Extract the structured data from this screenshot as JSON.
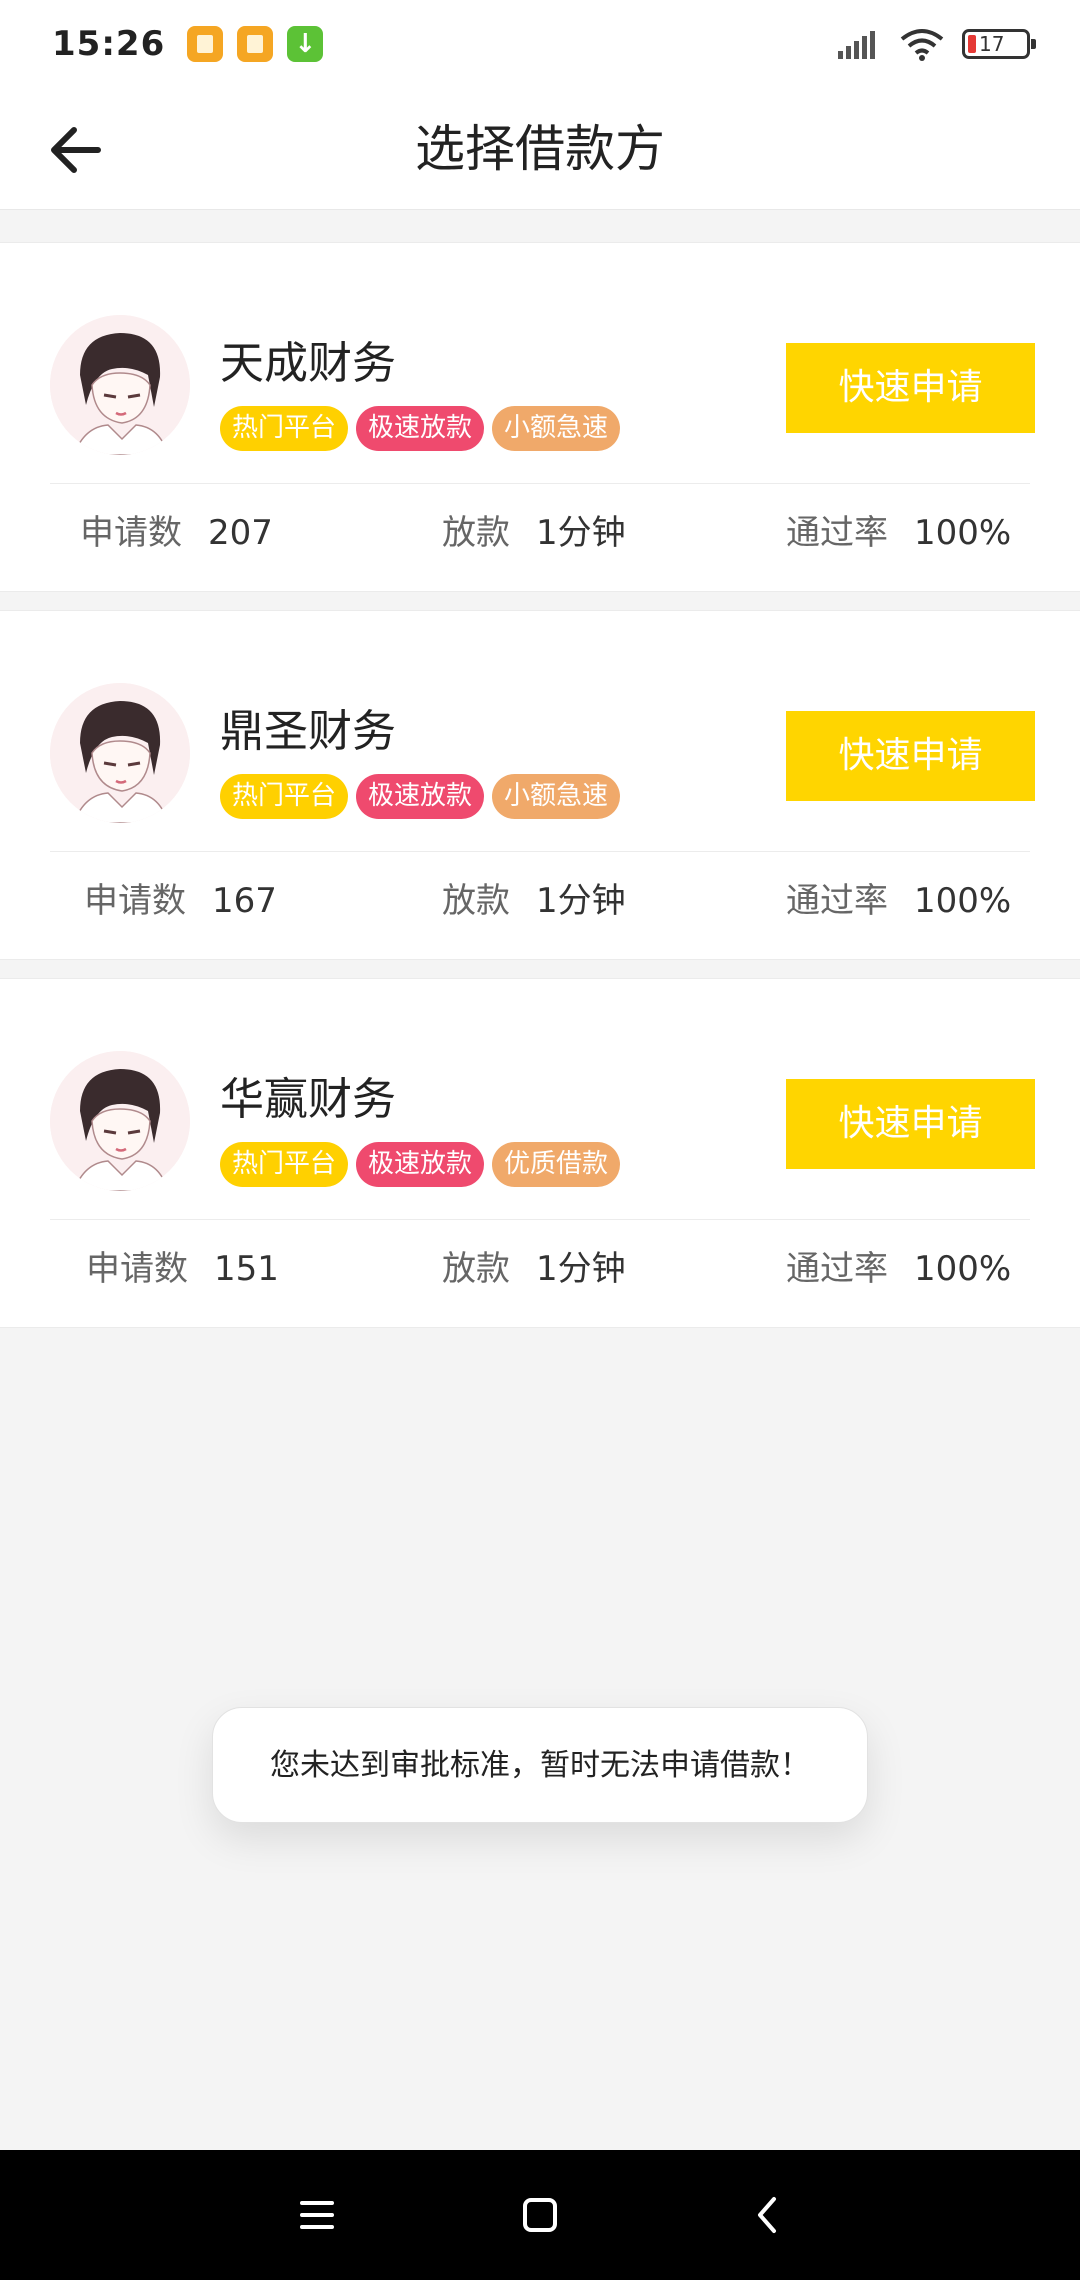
{
  "status_bar": {
    "time": "15:26",
    "battery": "17",
    "icons": [
      "app-orange-icon",
      "app-orange-icon",
      "download-app-icon",
      "signal-icon",
      "wifi-icon",
      "battery-icon"
    ]
  },
  "header": {
    "title": "选择借款方",
    "back_icon": "arrow-left-icon"
  },
  "lenders": [
    {
      "name": "天成财务",
      "tags": [
        "热门平台",
        "极速放款",
        "小额急速"
      ],
      "button": "快速申请",
      "applications_label": "申请数",
      "applications": "207",
      "loan_label": "放款",
      "loan_time": "1分钟",
      "pass_label": "通过率",
      "pass_rate": "100%"
    },
    {
      "name": "鼎圣财务",
      "tags": [
        "热门平台",
        "极速放款",
        "小额急速"
      ],
      "button": "快速申请",
      "applications_label": "申请数",
      "applications": "167",
      "loan_label": "放款",
      "loan_time": "1分钟",
      "pass_label": "通过率",
      "pass_rate": "100%"
    },
    {
      "name": "华赢财务",
      "tags": [
        "热门平台",
        "极速放款",
        "优质借款"
      ],
      "button": "快速申请",
      "applications_label": "申请数",
      "applications": "151",
      "loan_label": "放款",
      "loan_time": "1分钟",
      "pass_label": "通过率",
      "pass_rate": "100%"
    }
  ],
  "toast": "您未达到审批标准，暂时无法申请借款！",
  "nav_bar": {
    "icons": [
      "menu-icon",
      "home-icon",
      "back-icon"
    ]
  },
  "colors": {
    "accent": "#ffd500",
    "tag_hot": "#ffd000",
    "tag_fast": "#ef4a6e",
    "tag_small": "#f0a96a",
    "background": "#f4f4f4"
  }
}
